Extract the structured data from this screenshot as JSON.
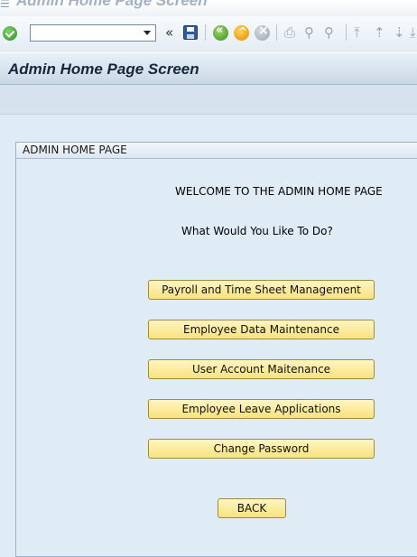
{
  "window": {
    "title": "Admin Home Page Screen"
  },
  "toolbar": {
    "icons": [
      "check-icon",
      "dropdown-icon",
      "history-icon",
      "save-icon",
      "back-icon",
      "exit-icon",
      "cancel-icon",
      "print-icon",
      "find-icon",
      "find-next-icon",
      "first-page-icon",
      "previous-page-icon",
      "next-page-icon",
      "last-page-icon"
    ],
    "history_glyph": "«"
  },
  "screen": {
    "title": "Admin Home Page Screen"
  },
  "group": {
    "title": "ADMIN HOME PAGE"
  },
  "content": {
    "welcome": "WELCOME TO THE ADMIN HOME PAGE",
    "question": "What Would You Like To Do?"
  },
  "buttons": [
    {
      "label": "Payroll and Time Sheet Management"
    },
    {
      "label": "Employee Data Maintenance"
    },
    {
      "label": "User Account Maitenance"
    },
    {
      "label": "Employee Leave Applications"
    },
    {
      "label": "Change Password"
    }
  ],
  "back_button": {
    "label": "BACK"
  },
  "colors": {
    "button_fill": "#f8e27f",
    "background": "#dfebf5",
    "title_color": "#16283a"
  }
}
